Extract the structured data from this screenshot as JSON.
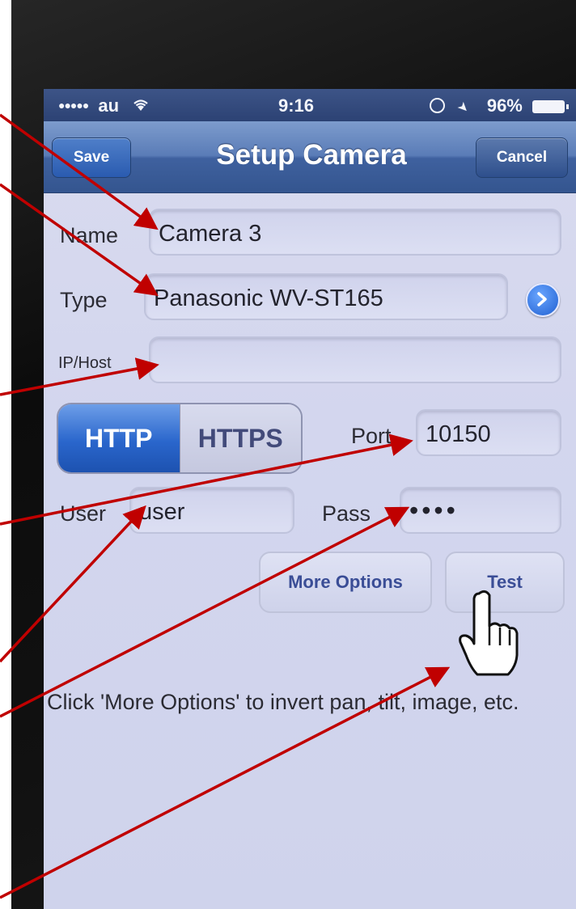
{
  "status_bar": {
    "carrier": "au",
    "time": "9:16",
    "battery": "96%"
  },
  "nav": {
    "title": "Setup Camera",
    "save_label": "Save",
    "cancel_label": "Cancel"
  },
  "form": {
    "name_label": "Name",
    "name_value": "Camera 3",
    "type_label": "Type",
    "type_value": "Panasonic WV-ST165",
    "host_label": "IP/Host",
    "host_value": "",
    "protocol_http": "HTTP",
    "protocol_https": "HTTPS",
    "protocol_selected": "HTTP",
    "port_label": "Port",
    "port_value": "10150",
    "user_label": "User",
    "user_value": "user",
    "pass_label": "Pass",
    "pass_value": "••••",
    "more_options_label": "More Options",
    "test_label": "Test"
  },
  "info_text": "Click 'More Options' to invert pan, tilt, image, etc.",
  "colors": {
    "annotation_arrow": "#c00000",
    "nav_bar": "#4a6aa8",
    "segment_selected": "#2a66cc",
    "screen_background": "#d6d9ef"
  },
  "icons": {
    "disclosure": "chevron-right-icon",
    "pointer": "hand-pointer-icon"
  }
}
